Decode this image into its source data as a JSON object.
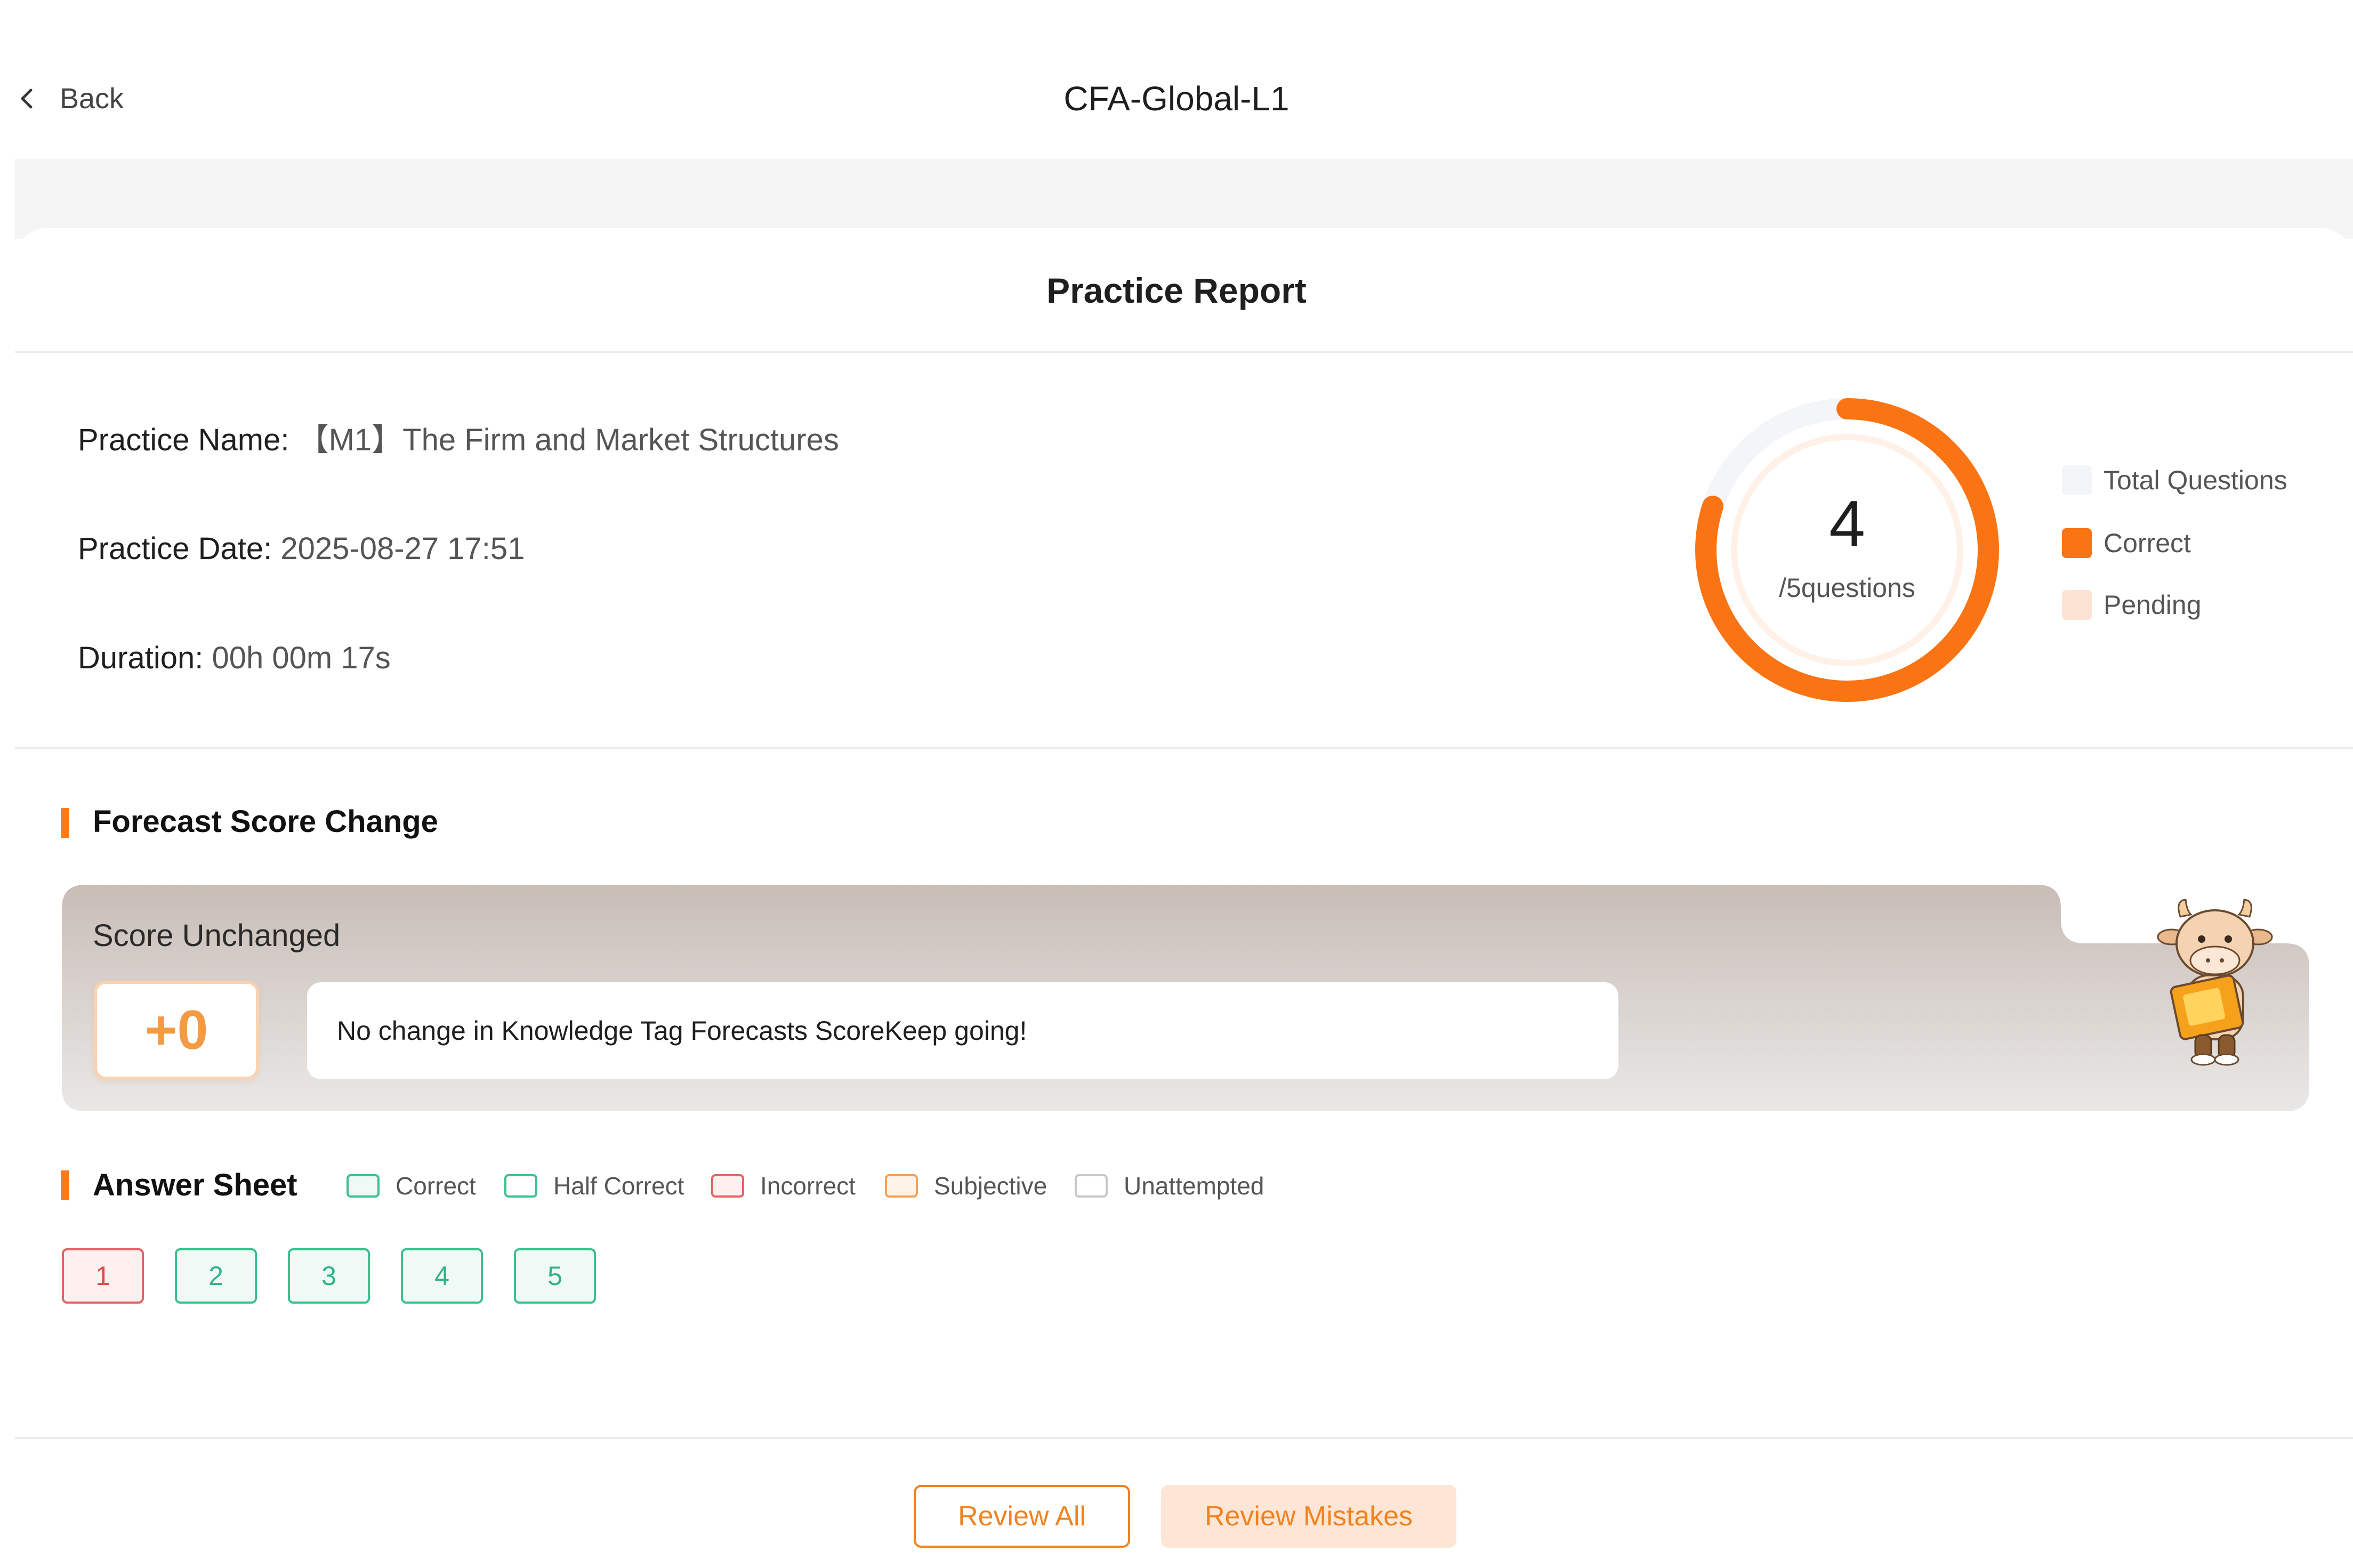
{
  "header": {
    "back_label": "Back",
    "title": "CFA-Global-L1"
  },
  "report": {
    "title": "Practice Report",
    "practice_name_label": "Practice Name:",
    "practice_name_value": "【M1】The Firm and Market Structures",
    "practice_date_label": "Practice Date:",
    "practice_date_value": "2025-08-27 17:51",
    "duration_label": "Duration:",
    "duration_value": "00h 00m 17s"
  },
  "donut": {
    "correct_count": "4",
    "total_label": "/5questions",
    "correct_fraction": 0.8,
    "colors": {
      "correct": "#fa7414",
      "total": "#f4f5f9",
      "pending": "#fde3d3"
    }
  },
  "legend": [
    "Total Questions",
    "Correct",
    "Pending"
  ],
  "forecast": {
    "section_title": "Forecast Score Change",
    "status": "Score Unchanged",
    "score_delta": "+0",
    "message": "No change in Knowledge Tag Forecasts ScoreKeep going!"
  },
  "answer_sheet": {
    "section_title": "Answer Sheet",
    "legend": [
      "Correct",
      "Half Correct",
      "Incorrect",
      "Subjective",
      "Unattempted"
    ],
    "questions": [
      {
        "number": "1",
        "status": "incorrect"
      },
      {
        "number": "2",
        "status": "correct"
      },
      {
        "number": "3",
        "status": "correct"
      },
      {
        "number": "4",
        "status": "correct"
      },
      {
        "number": "5",
        "status": "correct"
      }
    ]
  },
  "buttons": {
    "review_all": "Review All",
    "review_mistakes": "Review Mistakes"
  },
  "colors": {
    "accent": "#fa7a1e",
    "correct": "#3cc08e",
    "incorrect": "#e26565"
  }
}
